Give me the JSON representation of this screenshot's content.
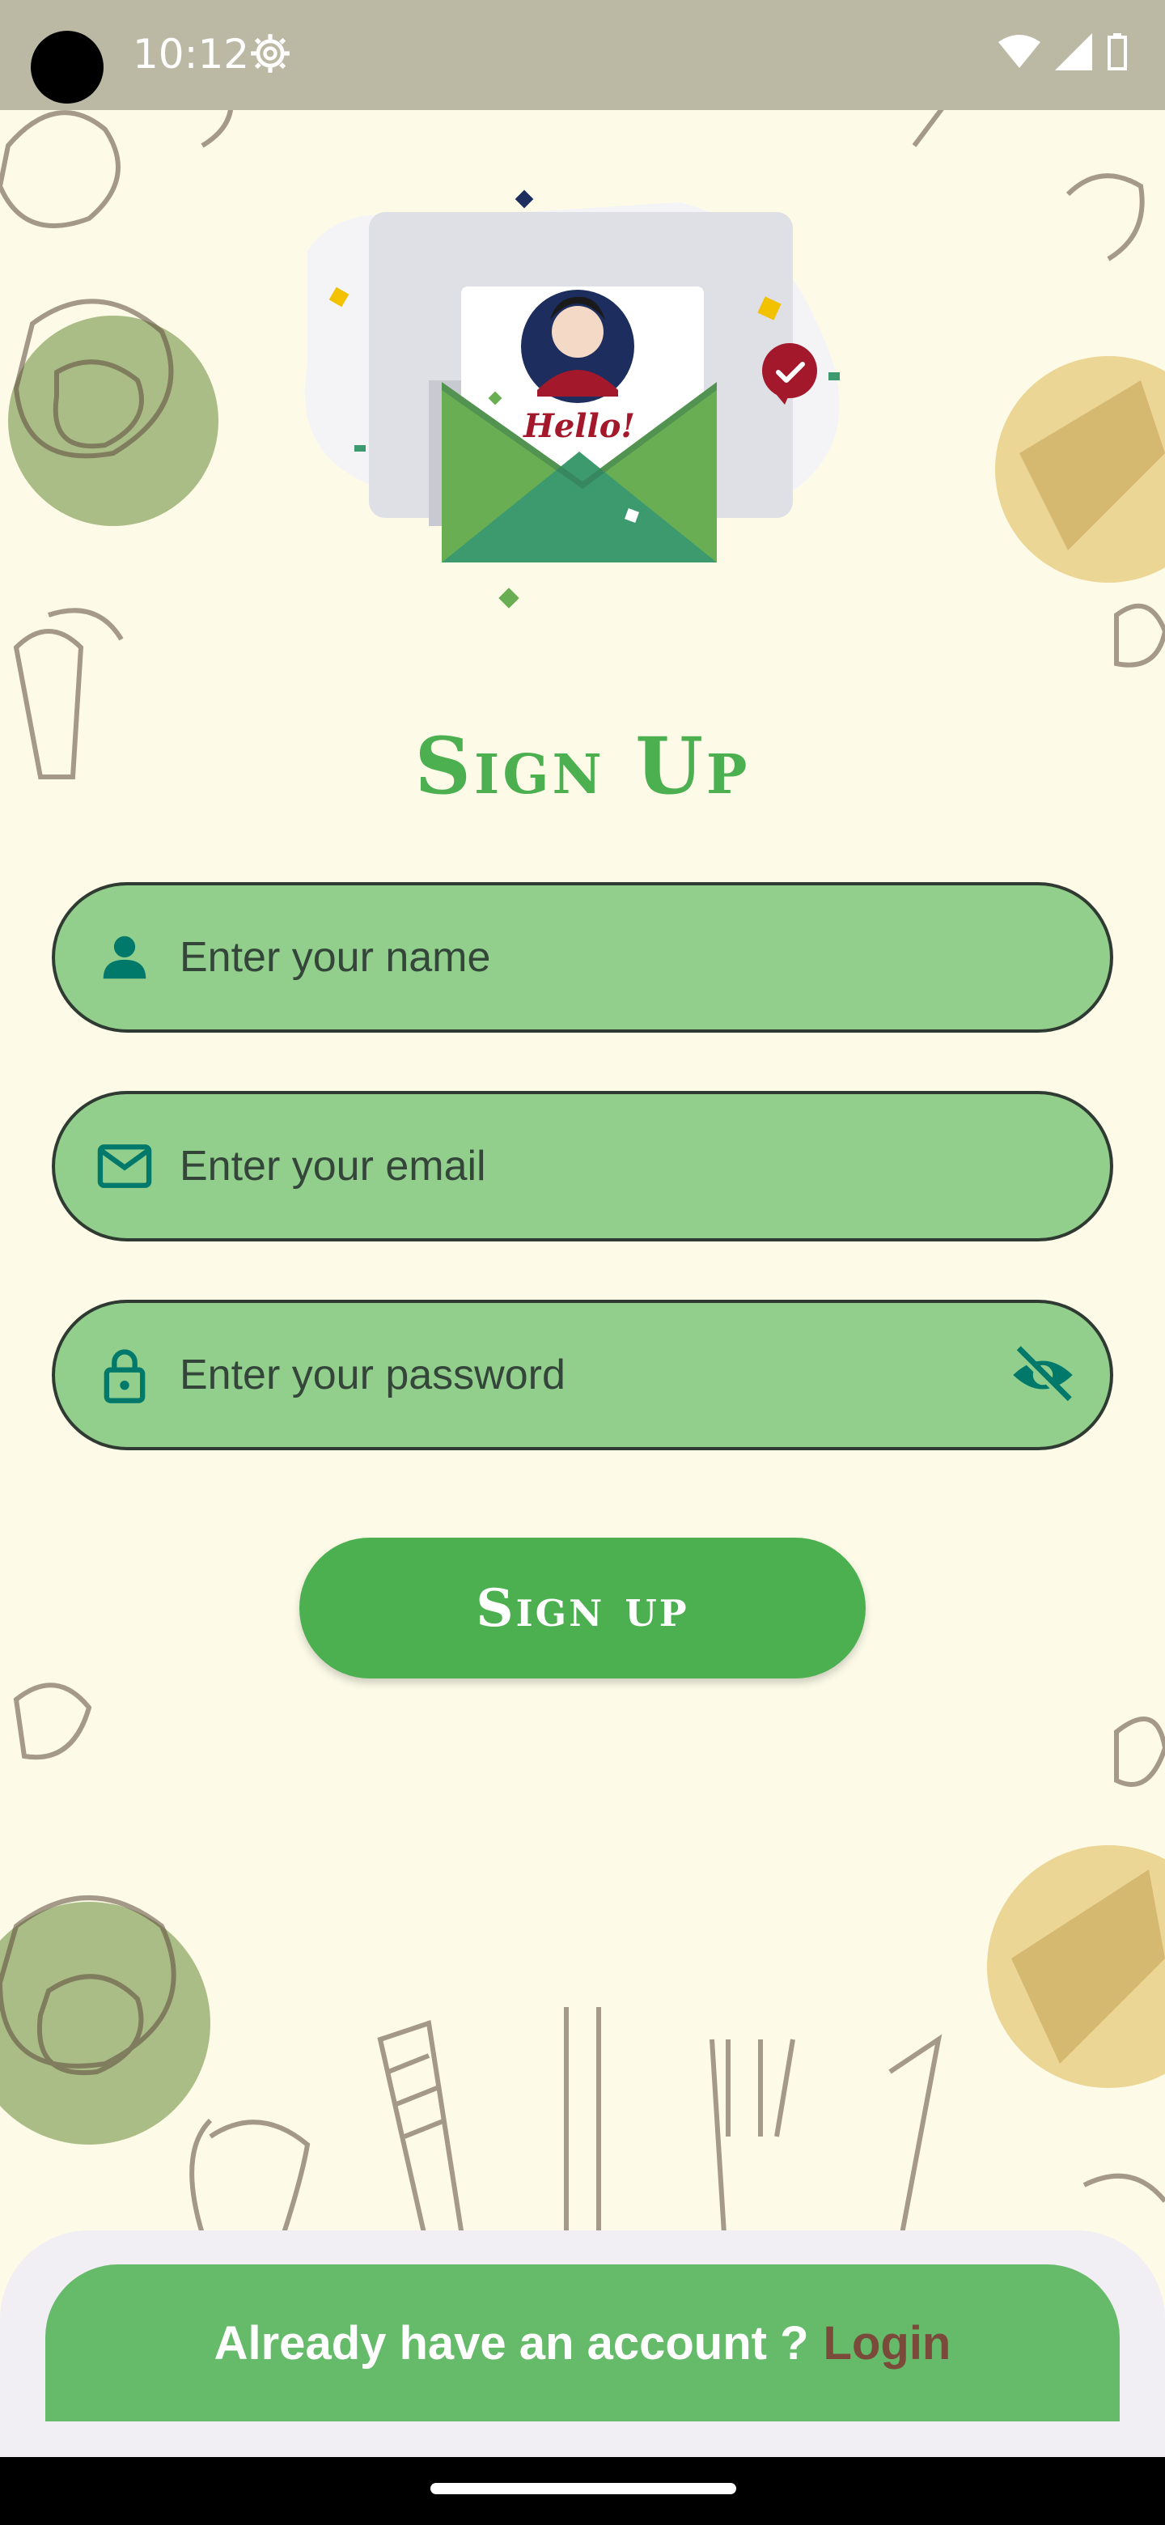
{
  "status_bar": {
    "time": "10:12"
  },
  "hero": {
    "card_text": "Hello!"
  },
  "title": "Sign Up",
  "form": {
    "name_placeholder": "Enter your name",
    "email_placeholder": "Enter your email",
    "password_placeholder": "Enter your password"
  },
  "signup_button": "Sign up",
  "footer": {
    "prompt": "Already have an account ?",
    "login_label": "Login"
  },
  "colors": {
    "accent": "#4caf50",
    "field_bg": "#93cf8c",
    "bottom_bar": "#66bb6a",
    "login_link": "#7a4a3a",
    "icon_teal": "#00796b"
  },
  "icons": {
    "name": "person-icon",
    "email": "mail-icon",
    "password": "lock-icon",
    "visibility": "visibility-off-icon"
  }
}
